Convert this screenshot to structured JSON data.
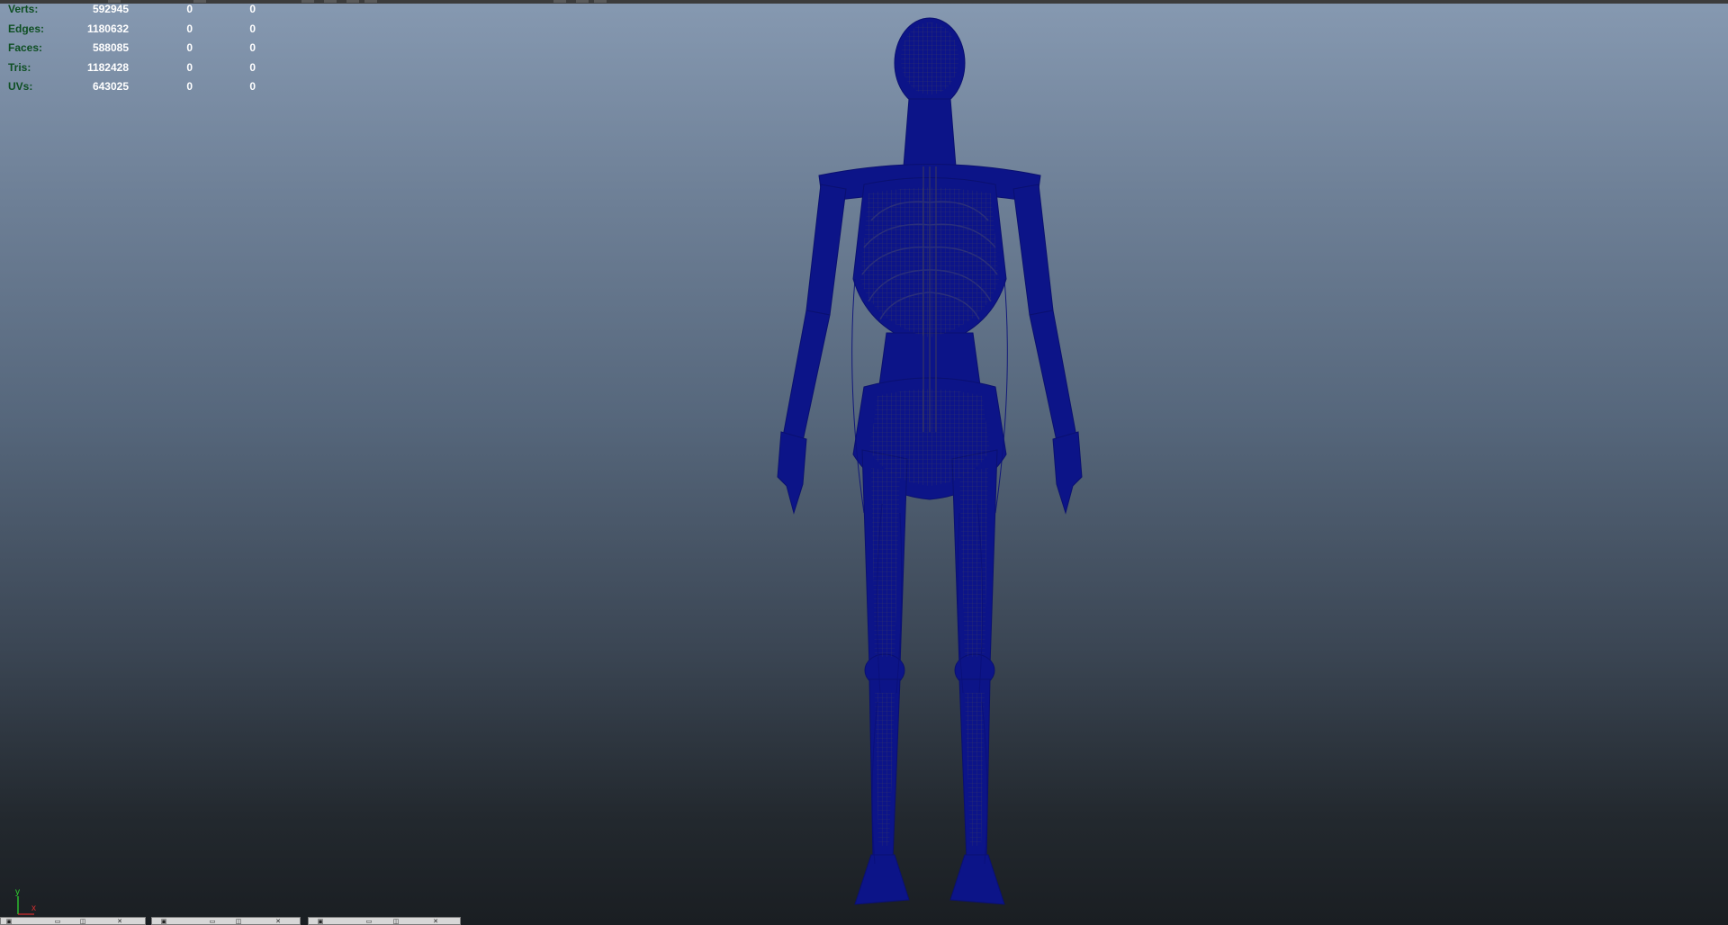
{
  "hud": {
    "rows": [
      {
        "label": "Verts:",
        "values": [
          "592945",
          "0",
          "0"
        ]
      },
      {
        "label": "Edges:",
        "values": [
          "1180632",
          "0",
          "0"
        ]
      },
      {
        "label": "Faces:",
        "values": [
          "588085",
          "0",
          "0"
        ]
      },
      {
        "label": "Tris:",
        "values": [
          "1182428",
          "0",
          "0"
        ]
      },
      {
        "label": "UVs:",
        "values": [
          "643025",
          "0",
          "0"
        ]
      }
    ]
  },
  "axis_gizmo": {
    "y_label": "y",
    "x_label": "x",
    "y_color": "#2fd22f",
    "x_color": "#d22f2f"
  },
  "viewport": {
    "mesh_color": "#0c1488",
    "background_top": "#8699b1",
    "background_bottom": "#1a1e22"
  },
  "shelf": {
    "tabs": [
      {
        "name": "panel-1",
        "buttons": [
          "maximize-icon",
          "restore-icon",
          "close-icon"
        ]
      },
      {
        "name": "panel-2",
        "buttons": [
          "maximize-icon",
          "restore-icon",
          "close-icon"
        ]
      },
      {
        "name": "panel-3",
        "buttons": [
          "maximize-icon",
          "restore-icon",
          "close-icon"
        ]
      }
    ]
  }
}
